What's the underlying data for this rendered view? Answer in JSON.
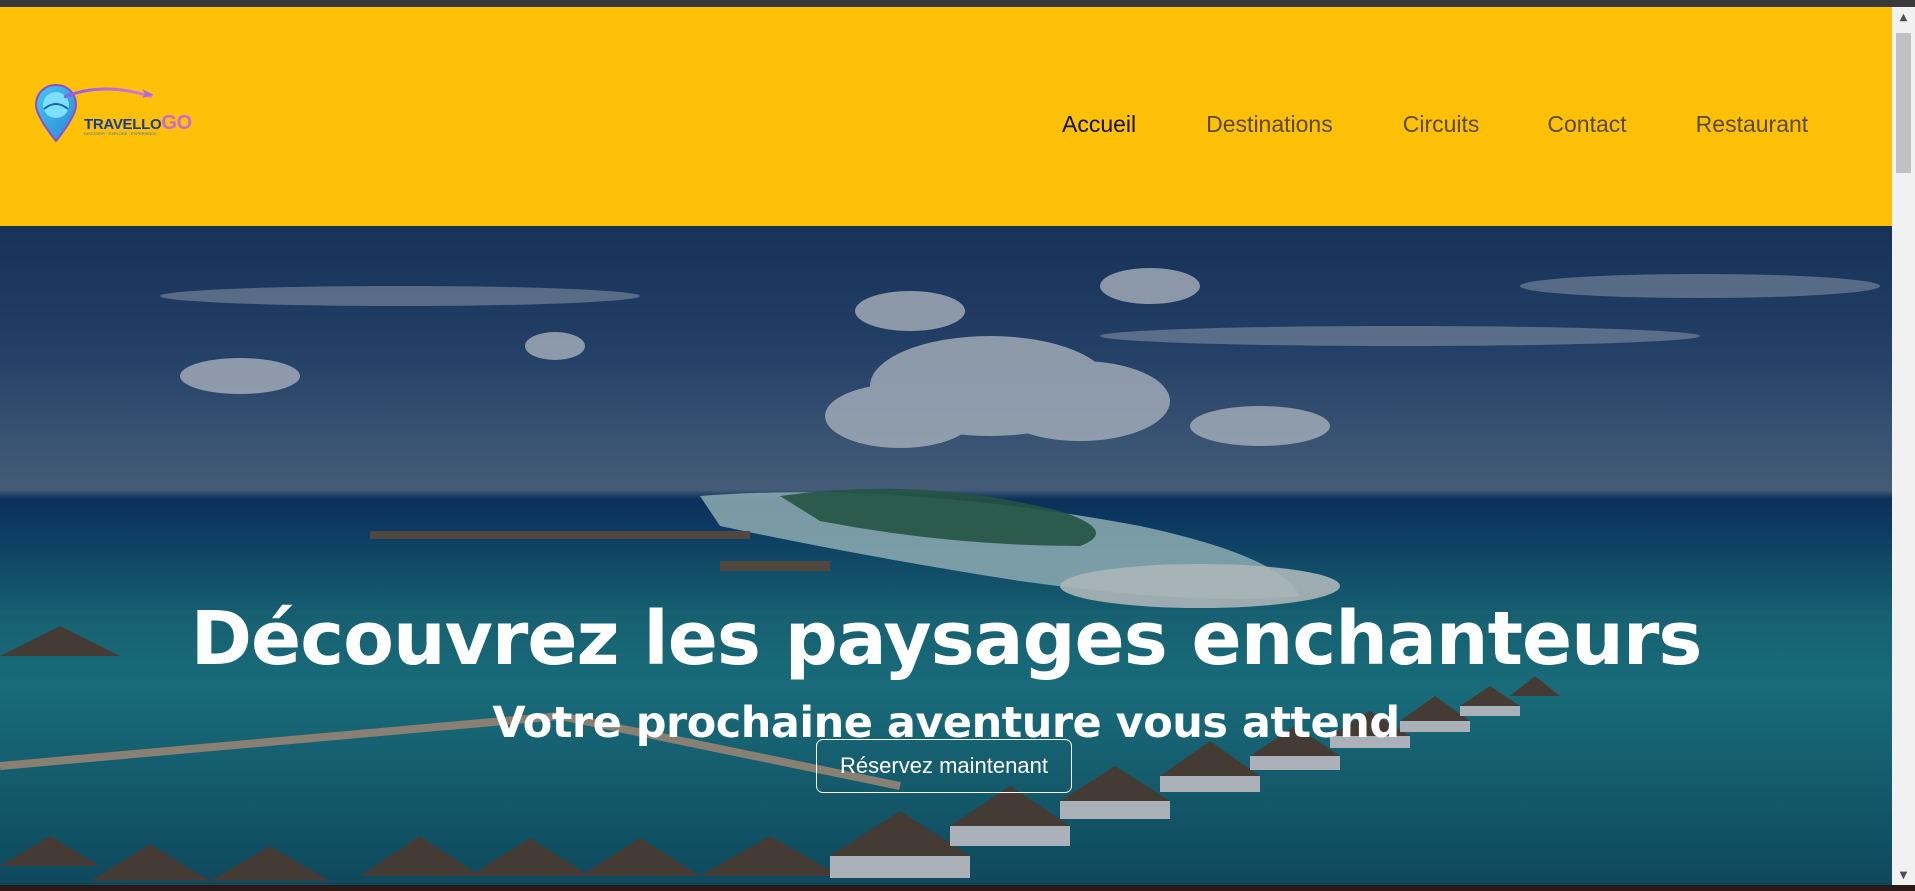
{
  "navbar": {
    "background_color": "#FFC107",
    "logo": {
      "alt": "TravelloGo logo",
      "word_part1": "TRAVELLO",
      "word_part2": "GO",
      "tagline": "DISCOVER · EXPLORE · EXPERIENCE"
    },
    "links": [
      {
        "label": "Accueil",
        "active": true
      },
      {
        "label": "Destinations",
        "active": false
      },
      {
        "label": "Circuits",
        "active": false
      },
      {
        "label": "Contact",
        "active": false
      },
      {
        "label": "Restaurant",
        "active": false
      }
    ]
  },
  "hero": {
    "title": "Découvrez les paysages enchanteurs",
    "subtitle": "Votre prochaine aventure vous attend",
    "cta_label": "Réservez maintenant",
    "background_description_icon": "tropical-island-photo"
  },
  "scrollbar": {
    "up_icon": "arrow-up-icon",
    "down_icon": "arrow-down-icon"
  },
  "colors": {
    "accent": "#FFC107",
    "hero_text": "#ffffff",
    "nav_active": "#111111",
    "nav_inactive": "#5a4a1f"
  }
}
